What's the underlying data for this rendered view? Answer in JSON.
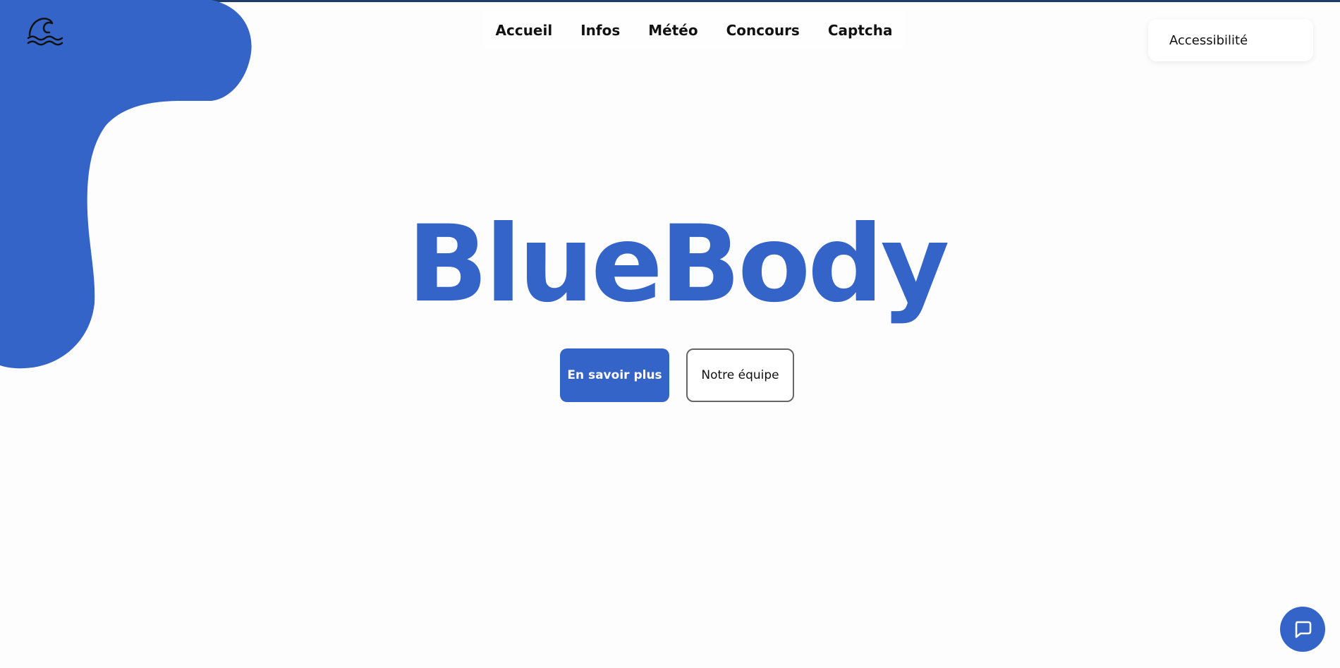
{
  "nav": {
    "items": [
      {
        "label": "Accueil"
      },
      {
        "label": "Infos"
      },
      {
        "label": "Météo"
      },
      {
        "label": "Concours"
      },
      {
        "label": "Captcha"
      }
    ]
  },
  "accessibility": {
    "label": "Accessibilité"
  },
  "hero": {
    "title": "BlueBody",
    "primary_button": "En savoir plus",
    "secondary_button": "Notre équipe"
  },
  "icons": {
    "logo": "wave-icon",
    "chat": "chat-icon"
  },
  "colors": {
    "brand_blue": "#3464c8",
    "top_border": "#1f3b6b",
    "background": "#fdfdfd"
  }
}
